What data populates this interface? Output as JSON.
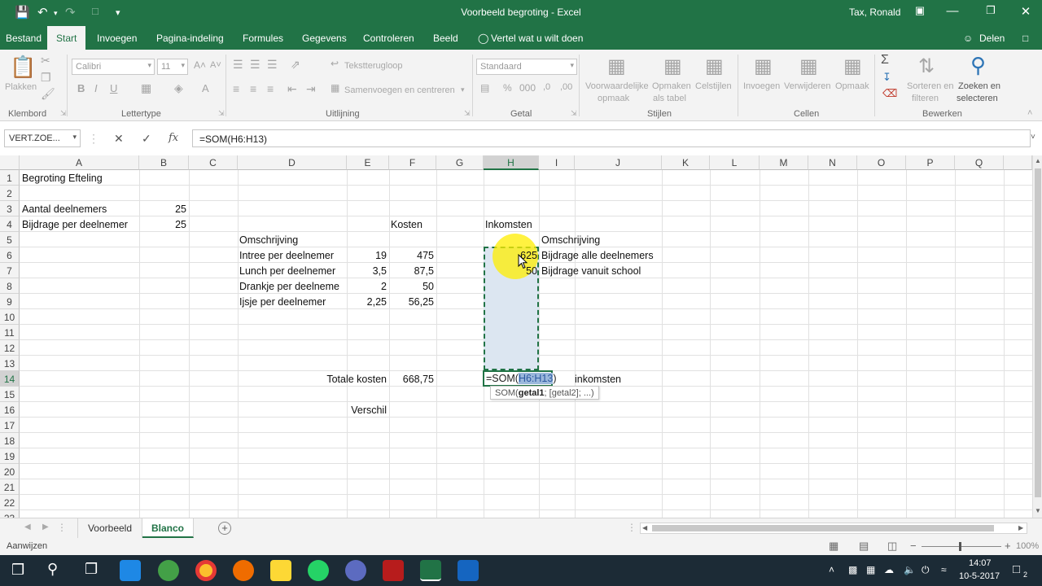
{
  "window": {
    "title": "Voorbeeld begroting  -  Excel",
    "user": "Tax, Ronald"
  },
  "tabs": [
    "Bestand",
    "Start",
    "Invoegen",
    "Pagina-indeling",
    "Formules",
    "Gegevens",
    "Controleren",
    "Beeld"
  ],
  "tell_me": "Vertel wat u wilt doen",
  "share": "Delen",
  "ribbon": {
    "paste": "Plakken",
    "font_name": "Calibri",
    "font_size": "11",
    "bold": "B",
    "italic": "I",
    "underline": "U",
    "wrap_text": "Tekstterugloop",
    "merge": "Samenvoegen en centreren",
    "number_format": "Standaard",
    "cond_format_1": "Voorwaardelijke",
    "cond_format_2": "opmaak",
    "format_table_1": "Opmaken",
    "format_table_2": "als tabel",
    "cell_styles": "Celstijlen",
    "insert": "Invoegen",
    "delete": "Verwijderen",
    "format": "Opmaak",
    "sort_1": "Sorteren en",
    "sort_2": "filteren",
    "find_1": "Zoeken en",
    "find_2": "selecteren",
    "groups": {
      "clipboard": "Klembord",
      "font": "Lettertype",
      "alignment": "Uitlijning",
      "number": "Getal",
      "styles": "Stijlen",
      "cells": "Cellen",
      "editing": "Bewerken"
    }
  },
  "formula_bar": {
    "name_box": "VERT.ZOE...",
    "fx": "fx",
    "formula": "=SOM(H6:H13)"
  },
  "columns": [
    "A",
    "B",
    "C",
    "D",
    "E",
    "F",
    "G",
    "H",
    "I",
    "J",
    "K",
    "L",
    "M",
    "N",
    "O",
    "P",
    "Q"
  ],
  "rows": [
    "1",
    "2",
    "3",
    "4",
    "5",
    "6",
    "7",
    "8",
    "9",
    "10",
    "11",
    "12",
    "13",
    "14",
    "15",
    "16",
    "17",
    "18",
    "19",
    "20",
    "21",
    "22",
    "23"
  ],
  "cells": {
    "A1": "Begroting Efteling",
    "A3": "Aantal deelnemers",
    "B3": "25",
    "A4": "Bijdrage per deelnemer",
    "B4": "25",
    "F4": "Kosten",
    "H4": "Inkomsten",
    "D5": "Omschrijving",
    "I5": "Omschrijving",
    "D6": "Intree per deelnemer",
    "E6": "19",
    "F6": "475",
    "H6": "625",
    "I6": "Bijdrage alle deelnemers",
    "D7": "Lunch per deelnemer",
    "E7": "3,5",
    "F7": "87,5",
    "H7": "50",
    "I7": "Bijdrage vanuit school",
    "D8": "Drankje per deelneme",
    "E8": "2",
    "F8": "50",
    "D9": "Ijsje per deelnemer",
    "E9": "2,25",
    "F9": "56,25",
    "E14": "Totale kosten",
    "F14": "668,75",
    "H14_prefix": "=SOM(",
    "H14_ref": "H6:H13",
    "H14_suffix": ")",
    "J14": "inkomsten",
    "E16": "Verschil"
  },
  "tooltip": {
    "func": "SOM(",
    "arg1": "getal1",
    "rest": "; [getal2]; ...)"
  },
  "sheets": [
    "Voorbeeld",
    "Blanco"
  ],
  "active_sheet": "Blanco",
  "status": "Aanwijzen",
  "zoom": "100%",
  "taskbar": {
    "time": "14:07",
    "date": "10-5-2017",
    "notifications": "2"
  },
  "colors": {
    "excel_green": "#217346",
    "selection_fill": "#dce6f1",
    "highlight": "#ffee00"
  }
}
